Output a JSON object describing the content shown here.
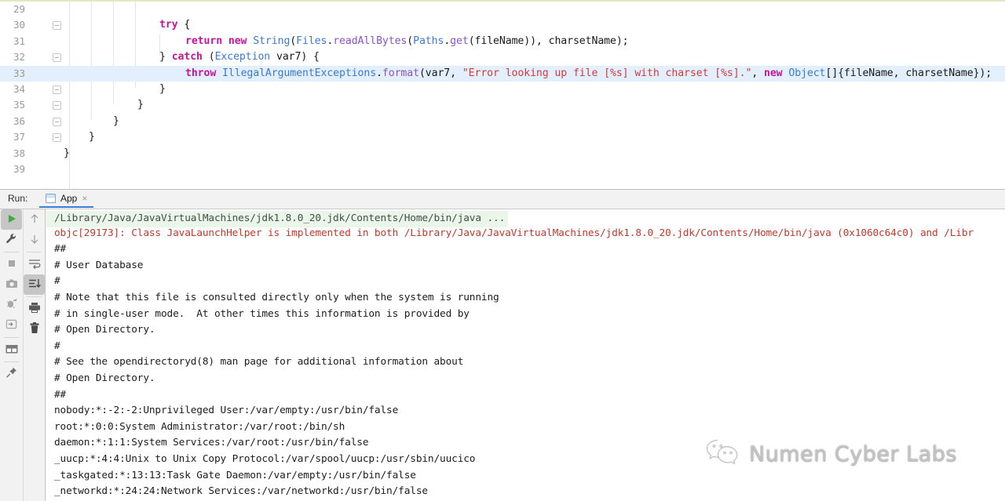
{
  "editor": {
    "first_line_number": 29,
    "highlighted_line": 33,
    "lines": [
      {
        "n": "29",
        "fold": "none",
        "text": ""
      },
      {
        "n": "30",
        "fold": "open",
        "text": "try_block"
      },
      {
        "n": "31",
        "fold": "none",
        "text": "return_line"
      },
      {
        "n": "32",
        "fold": "plus",
        "text": "catch_line"
      },
      {
        "n": "33",
        "fold": "none",
        "text": "throw_line"
      },
      {
        "n": "34",
        "fold": "plus",
        "text": "brace1"
      },
      {
        "n": "35",
        "fold": "plus",
        "text": "brace2"
      },
      {
        "n": "36",
        "fold": "plus",
        "text": "brace3"
      },
      {
        "n": "37",
        "fold": "plus",
        "text": "brace4"
      },
      {
        "n": "38",
        "fold": "none",
        "text": "brace5"
      },
      {
        "n": "39",
        "fold": "none",
        "text": ""
      }
    ],
    "tokens": {
      "try": "try",
      "brace_open": " {",
      "return": "return",
      "new": "new",
      "String": "String",
      "Files": "Files",
      "readAllBytes": "readAllBytes",
      "Paths": "Paths",
      "get": "get",
      "fileName": "fileName",
      "charsetName": "charsetName",
      "catch": "catch",
      "Exception": "Exception",
      "var7": "var7",
      "throw": "throw",
      "IllegalArgumentExceptions": "IllegalArgumentExceptions",
      "format": "format",
      "error_string": "\"Error looking up file [%s] with charset [%s].\"",
      "Object": "Object",
      "closing_brace": "}"
    }
  },
  "run_panel": {
    "label": "Run:",
    "tab": {
      "name": "App",
      "close": "×",
      "icon": "java-class-icon"
    },
    "accent_color": "#3b7ddd",
    "toolbar_left": [
      {
        "name": "rerun-button",
        "icon": "play-icon",
        "selected": true
      },
      {
        "name": "settings-button",
        "icon": "wrench-icon",
        "selected": false
      },
      {
        "name": "stop-button",
        "icon": "stop-icon",
        "selected": false
      },
      {
        "name": "screenshot-button",
        "icon": "camera-icon",
        "selected": false
      },
      {
        "name": "debug-button",
        "icon": "bug-icon",
        "selected": false
      },
      {
        "name": "export-button",
        "icon": "export-icon",
        "selected": false
      },
      {
        "name": "layout-button",
        "icon": "layout-icon",
        "selected": false
      },
      {
        "name": "pin-button",
        "icon": "pin-icon",
        "selected": false
      }
    ],
    "toolbar_right": [
      {
        "name": "up-button",
        "icon": "arrow-up-icon",
        "selected": false
      },
      {
        "name": "down-button",
        "icon": "arrow-down-icon",
        "selected": false
      },
      {
        "name": "soft-wrap-button",
        "icon": "soft-wrap-icon",
        "selected": false
      },
      {
        "name": "scroll-to-end-button",
        "icon": "scroll-end-icon",
        "selected": true
      },
      {
        "name": "print-button",
        "icon": "printer-icon",
        "selected": false
      },
      {
        "name": "clear-all-button",
        "icon": "trash-icon",
        "selected": false
      }
    ],
    "console_lines": [
      {
        "text": "/Library/Java/JavaVirtualMachines/jdk1.8.0_20.jdk/Contents/Home/bin/java ...",
        "style": "green"
      },
      {
        "text": "objc[29173]: Class JavaLaunchHelper is implemented in both /Library/Java/JavaVirtualMachines/jdk1.8.0_20.jdk/Contents/Home/bin/java (0x1060c64c0) and /Libr",
        "style": "err"
      },
      {
        "text": "##",
        "style": "plain"
      },
      {
        "text": "# User Database",
        "style": "plain"
      },
      {
        "text": "#",
        "style": "plain"
      },
      {
        "text": "# Note that this file is consulted directly only when the system is running",
        "style": "plain"
      },
      {
        "text": "# in single-user mode.  At other times this information is provided by",
        "style": "plain"
      },
      {
        "text": "# Open Directory.",
        "style": "plain"
      },
      {
        "text": "#",
        "style": "plain"
      },
      {
        "text": "# See the opendirectoryd(8) man page for additional information about",
        "style": "plain"
      },
      {
        "text": "# Open Directory.",
        "style": "plain"
      },
      {
        "text": "##",
        "style": "plain"
      },
      {
        "text": "nobody:*:-2:-2:Unprivileged User:/var/empty:/usr/bin/false",
        "style": "plain"
      },
      {
        "text": "root:*:0:0:System Administrator:/var/root:/bin/sh",
        "style": "plain"
      },
      {
        "text": "daemon:*:1:1:System Services:/var/root:/usr/bin/false",
        "style": "plain"
      },
      {
        "text": "_uucp:*:4:4:Unix to Unix Copy Protocol:/var/spool/uucp:/usr/sbin/uucico",
        "style": "plain"
      },
      {
        "text": "_taskgated:*:13:13:Task Gate Daemon:/var/empty:/usr/bin/false",
        "style": "plain"
      },
      {
        "text": "_networkd:*:24:24:Network Services:/var/networkd:/usr/bin/false",
        "style": "plain"
      }
    ]
  },
  "watermark": {
    "text": "Numen Cyber Labs",
    "icon": "wechat-icon"
  }
}
